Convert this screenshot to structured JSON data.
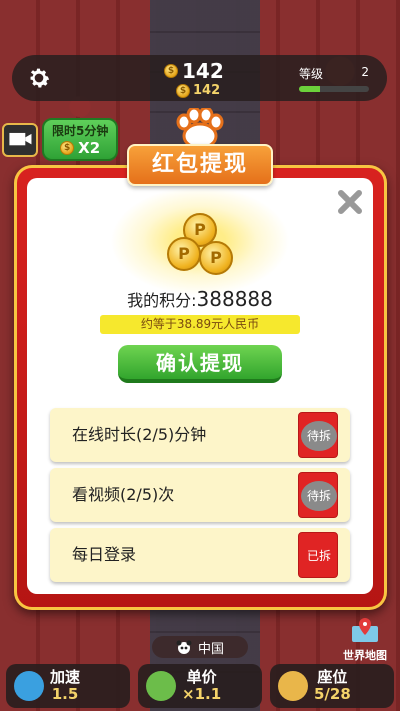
{
  "hud": {
    "score": "142",
    "score_sub": "142",
    "level_label": "等级",
    "level_value": "2",
    "level_progress": 0.3
  },
  "promo": {
    "label": "限时5分钟",
    "multiplier": "X2"
  },
  "modal": {
    "title": "红包提现",
    "points_label": "我的积分:",
    "points_value": "388888",
    "rmb_equiv": "约等于38.89元人民币",
    "confirm_label": "确认提现",
    "tasks": [
      {
        "label": "在线时长(2/5)分钟",
        "status": "待拆",
        "state": "pending"
      },
      {
        "label": "看视频(2/5)次",
        "status": "待拆",
        "state": "pending"
      },
      {
        "label": "每日登录",
        "status": "已拆",
        "state": "done"
      }
    ]
  },
  "bottom": {
    "country": "中国",
    "world_map": "世界地图",
    "stats": [
      {
        "label": "加速",
        "value": "1.5"
      },
      {
        "label": "单价",
        "value": "×1.1"
      },
      {
        "label": "座位",
        "value": "5/28"
      }
    ]
  },
  "colors": {
    "modal_red": "#d8221f",
    "confirm_green": "#32a52d",
    "title_orange": "#e5701a",
    "rmb_yellow": "#f6e82d",
    "task_bg": "#fdf5c9"
  }
}
